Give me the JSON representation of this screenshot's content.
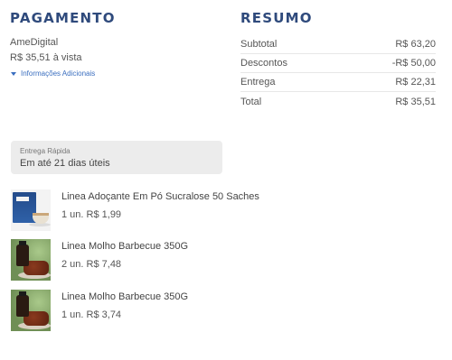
{
  "payment": {
    "title": "PAGAMENTO",
    "method": "AmeDigital",
    "price_line": "R$ 35,51 à vista",
    "more_info_label": "Informações Adicionais"
  },
  "summary": {
    "title": "RESUMO",
    "rows": [
      {
        "label": "Subtotal",
        "value": "R$ 63,20"
      },
      {
        "label": "Descontos",
        "value": "-R$ 50,00"
      },
      {
        "label": "Entrega",
        "value": "R$ 22,31"
      },
      {
        "label": "Total",
        "value": "R$ 35,51"
      }
    ]
  },
  "delivery": {
    "label": "Entrega Rápida",
    "time": "Em até 21 dias úteis"
  },
  "items": [
    {
      "name": "Linea Adoçante Em Pó Sucralose 50 Saches",
      "qty": "1 un. R$ 1,99",
      "icon": "sweetener-box-image"
    },
    {
      "name": "Linea Molho Barbecue 350G",
      "qty": "2 un. R$ 7,48",
      "icon": "bbq-sauce-image"
    },
    {
      "name": "Linea Molho Barbecue 350G",
      "qty": "1 un. R$ 3,74",
      "icon": "bbq-sauce-image"
    }
  ],
  "colors": {
    "title": "#2f4a7c",
    "link": "#3a6ebf",
    "delivery_box": "#ececec"
  }
}
